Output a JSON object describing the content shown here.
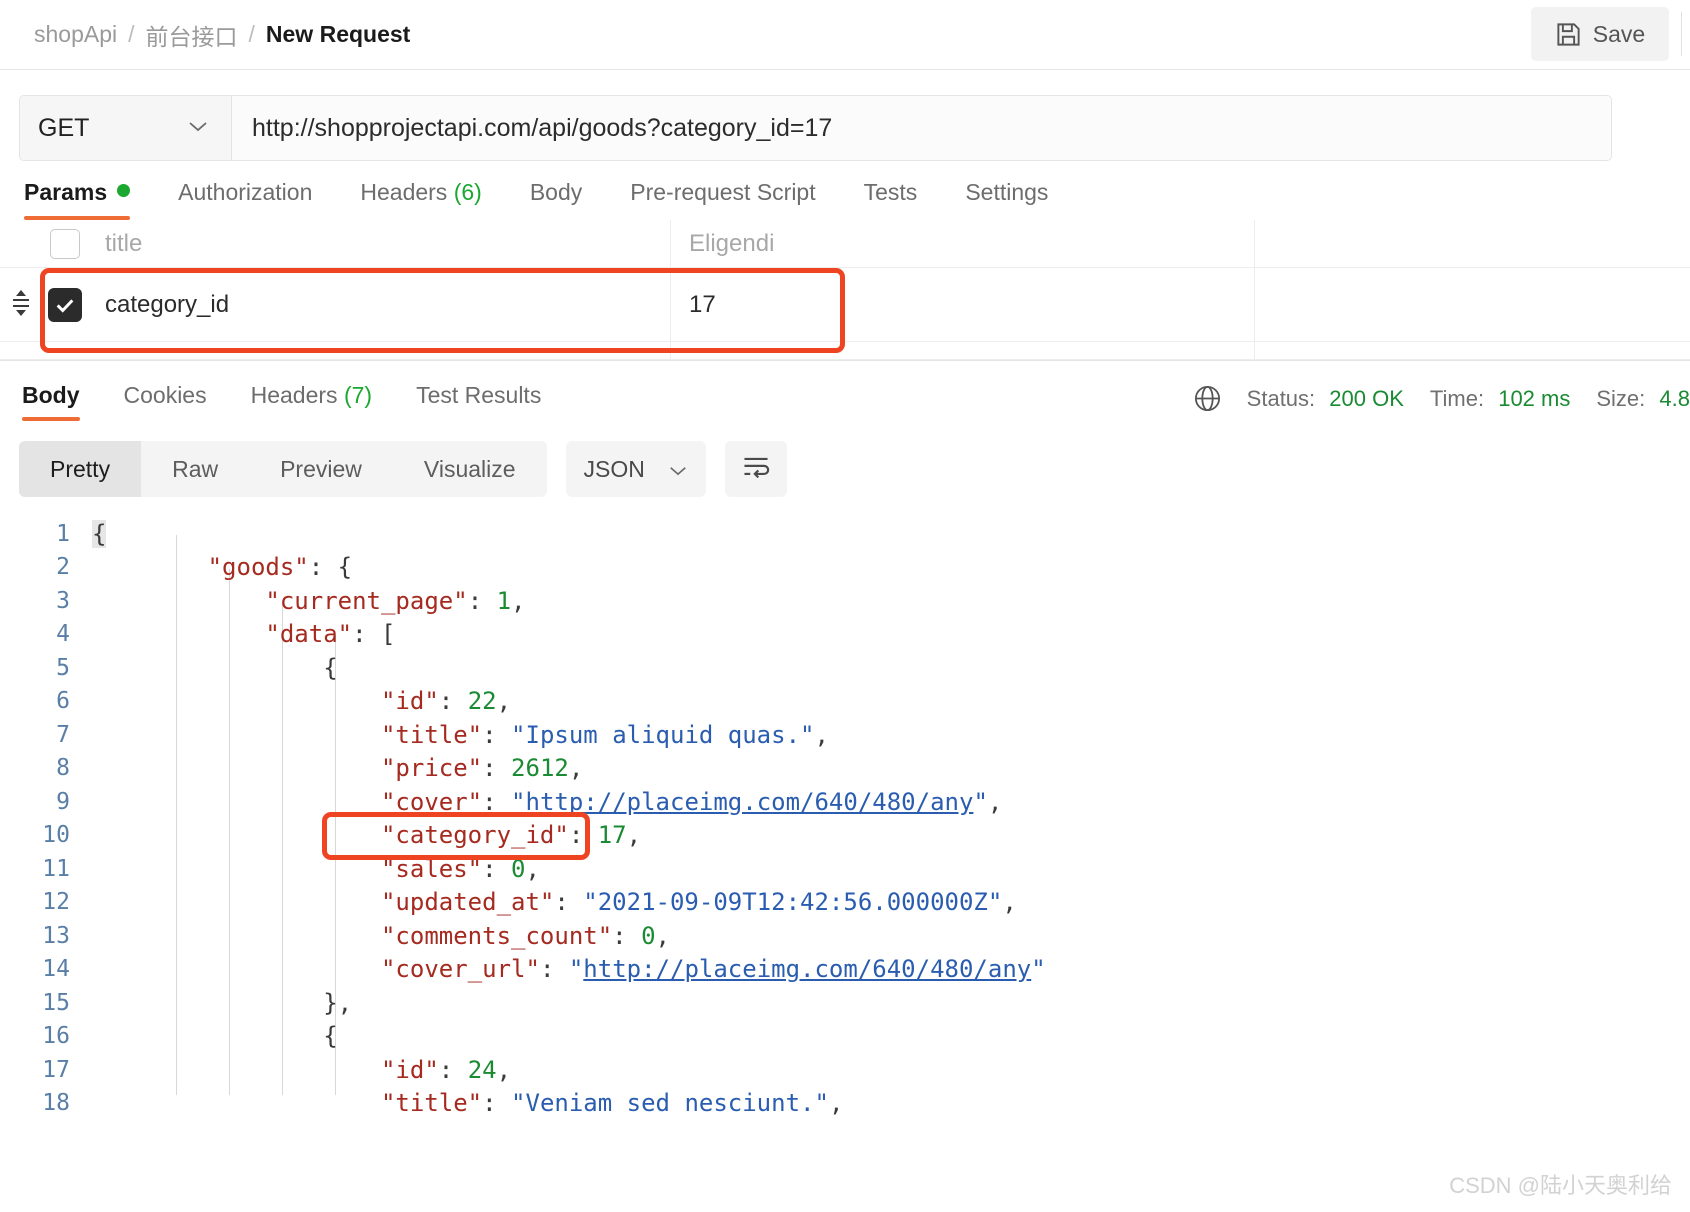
{
  "header": {
    "breadcrumb": [
      "shopApi",
      "前台接口",
      "New Request"
    ],
    "separator": "/",
    "save_label": "Save"
  },
  "request": {
    "method": "GET",
    "url": "http://shopprojectapi.com/api/goods?category_id=17",
    "tabs": [
      {
        "label": "Params",
        "badge": "dot",
        "active": true
      },
      {
        "label": "Authorization",
        "active": false
      },
      {
        "label": "Headers",
        "count": "(6)",
        "active": false
      },
      {
        "label": "Body",
        "active": false
      },
      {
        "label": "Pre-request Script",
        "active": false
      },
      {
        "label": "Tests",
        "active": false
      },
      {
        "label": "Settings",
        "active": false
      }
    ],
    "params": {
      "header_row": {
        "key_placeholder": "title",
        "value_placeholder": "Eligendi",
        "checked": false
      },
      "rows": [
        {
          "checked": true,
          "key": "category_id",
          "value": "17",
          "description": ""
        }
      ]
    }
  },
  "response": {
    "tabs": [
      {
        "label": "Body",
        "active": true
      },
      {
        "label": "Cookies",
        "active": false
      },
      {
        "label": "Headers",
        "count": "(7)",
        "active": false
      },
      {
        "label": "Test Results",
        "active": false
      }
    ],
    "status_label": "Status:",
    "status_value": "200 OK",
    "time_label": "Time:",
    "time_value": "102 ms",
    "size_label": "Size:",
    "size_value": "4.8",
    "view_modes": [
      "Pretty",
      "Raw",
      "Preview",
      "Visualize"
    ],
    "active_view": "Pretty",
    "format": "JSON",
    "body_lines": [
      {
        "num": "1",
        "indent": 0,
        "tokens": [
          {
            "t": "{",
            "c": "p"
          }
        ]
      },
      {
        "num": "2",
        "indent": 2,
        "tokens": [
          {
            "t": "\"goods\"",
            "c": "k"
          },
          {
            "t": ": ",
            "c": "p"
          },
          {
            "t": "{",
            "c": "p"
          }
        ]
      },
      {
        "num": "3",
        "indent": 3,
        "tokens": [
          {
            "t": "\"current_page\"",
            "c": "k"
          },
          {
            "t": ": ",
            "c": "p"
          },
          {
            "t": "1",
            "c": "n"
          },
          {
            "t": ",",
            "c": "p"
          }
        ]
      },
      {
        "num": "4",
        "indent": 3,
        "tokens": [
          {
            "t": "\"data\"",
            "c": "k"
          },
          {
            "t": ": ",
            "c": "p"
          },
          {
            "t": "[",
            "c": "p"
          }
        ]
      },
      {
        "num": "5",
        "indent": 4,
        "tokens": [
          {
            "t": "{",
            "c": "p"
          }
        ]
      },
      {
        "num": "6",
        "indent": 5,
        "tokens": [
          {
            "t": "\"id\"",
            "c": "k"
          },
          {
            "t": ": ",
            "c": "p"
          },
          {
            "t": "22",
            "c": "n"
          },
          {
            "t": ",",
            "c": "p"
          }
        ]
      },
      {
        "num": "7",
        "indent": 5,
        "tokens": [
          {
            "t": "\"title\"",
            "c": "k"
          },
          {
            "t": ": ",
            "c": "p"
          },
          {
            "t": "\"Ipsum aliquid quas.\"",
            "c": "s"
          },
          {
            "t": ",",
            "c": "p"
          }
        ]
      },
      {
        "num": "8",
        "indent": 5,
        "tokens": [
          {
            "t": "\"price\"",
            "c": "k"
          },
          {
            "t": ": ",
            "c": "p"
          },
          {
            "t": "2612",
            "c": "n"
          },
          {
            "t": ",",
            "c": "p"
          }
        ]
      },
      {
        "num": "9",
        "indent": 5,
        "tokens": [
          {
            "t": "\"cover\"",
            "c": "k"
          },
          {
            "t": ": ",
            "c": "p"
          },
          {
            "t": "\"",
            "c": "s"
          },
          {
            "t": "http://placeimg.com/640/480/any",
            "c": "lnk"
          },
          {
            "t": "\"",
            "c": "s"
          },
          {
            "t": ",",
            "c": "p"
          }
        ]
      },
      {
        "num": "10",
        "indent": 5,
        "tokens": [
          {
            "t": "\"category_id\"",
            "c": "k"
          },
          {
            "t": ": ",
            "c": "p"
          },
          {
            "t": "17",
            "c": "n"
          },
          {
            "t": ",",
            "c": "p"
          }
        ]
      },
      {
        "num": "11",
        "indent": 5,
        "tokens": [
          {
            "t": "\"sales\"",
            "c": "k"
          },
          {
            "t": ": ",
            "c": "p"
          },
          {
            "t": "0",
            "c": "n"
          },
          {
            "t": ",",
            "c": "p"
          }
        ]
      },
      {
        "num": "12",
        "indent": 5,
        "tokens": [
          {
            "t": "\"updated_at\"",
            "c": "k"
          },
          {
            "t": ": ",
            "c": "p"
          },
          {
            "t": "\"2021-09-09T12:42:56.000000Z\"",
            "c": "s"
          },
          {
            "t": ",",
            "c": "p"
          }
        ]
      },
      {
        "num": "13",
        "indent": 5,
        "tokens": [
          {
            "t": "\"comments_count\"",
            "c": "k"
          },
          {
            "t": ": ",
            "c": "p"
          },
          {
            "t": "0",
            "c": "n"
          },
          {
            "t": ",",
            "c": "p"
          }
        ]
      },
      {
        "num": "14",
        "indent": 5,
        "tokens": [
          {
            "t": "\"cover_url\"",
            "c": "k"
          },
          {
            "t": ": ",
            "c": "p"
          },
          {
            "t": "\"",
            "c": "s"
          },
          {
            "t": "http://placeimg.com/640/480/any",
            "c": "lnk"
          },
          {
            "t": "\"",
            "c": "s"
          }
        ]
      },
      {
        "num": "15",
        "indent": 4,
        "tokens": [
          {
            "t": "},",
            "c": "p"
          }
        ]
      },
      {
        "num": "16",
        "indent": 4,
        "tokens": [
          {
            "t": "{",
            "c": "p"
          }
        ]
      },
      {
        "num": "17",
        "indent": 5,
        "tokens": [
          {
            "t": "\"id\"",
            "c": "k"
          },
          {
            "t": ": ",
            "c": "p"
          },
          {
            "t": "24",
            "c": "n"
          },
          {
            "t": ",",
            "c": "p"
          }
        ]
      },
      {
        "num": "18",
        "indent": 5,
        "tokens": [
          {
            "t": "\"title\"",
            "c": "k"
          },
          {
            "t": ": ",
            "c": "p"
          },
          {
            "t": "\"Veniam sed nesciunt.\"",
            "c": "s"
          },
          {
            "t": ",",
            "c": "p"
          }
        ]
      }
    ]
  },
  "annotations": {
    "param_row_box": true,
    "category_id_line_box": true,
    "accent_color": "#ef4422"
  },
  "watermark": "CSDN @陆小天奥利给"
}
